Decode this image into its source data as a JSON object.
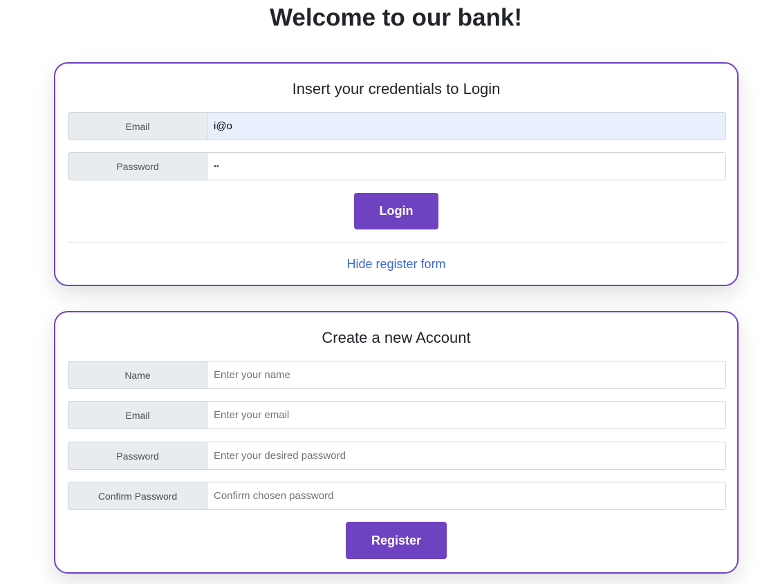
{
  "page": {
    "title": "Welcome to our bank!"
  },
  "login": {
    "title": "Insert your credentials to Login",
    "email_label": "Email",
    "email_value": "i@o",
    "password_label": "Password",
    "password_value": "••",
    "login_button": "Login",
    "toggle_link": "Hide register form"
  },
  "register": {
    "title": "Create a new Account",
    "name_label": "Name",
    "name_placeholder": "Enter your name",
    "email_label": "Email",
    "email_placeholder": "Enter your email",
    "password_label": "Password",
    "password_placeholder": "Enter your desired password",
    "confirm_label": "Confirm Password",
    "confirm_placeholder": "Confirm chosen password",
    "register_button": "Register"
  },
  "colors": {
    "accent": "#6f42c1",
    "link": "#3b67d6",
    "label_bg": "#e9ecef",
    "autofill_bg": "#e8f0fe"
  }
}
